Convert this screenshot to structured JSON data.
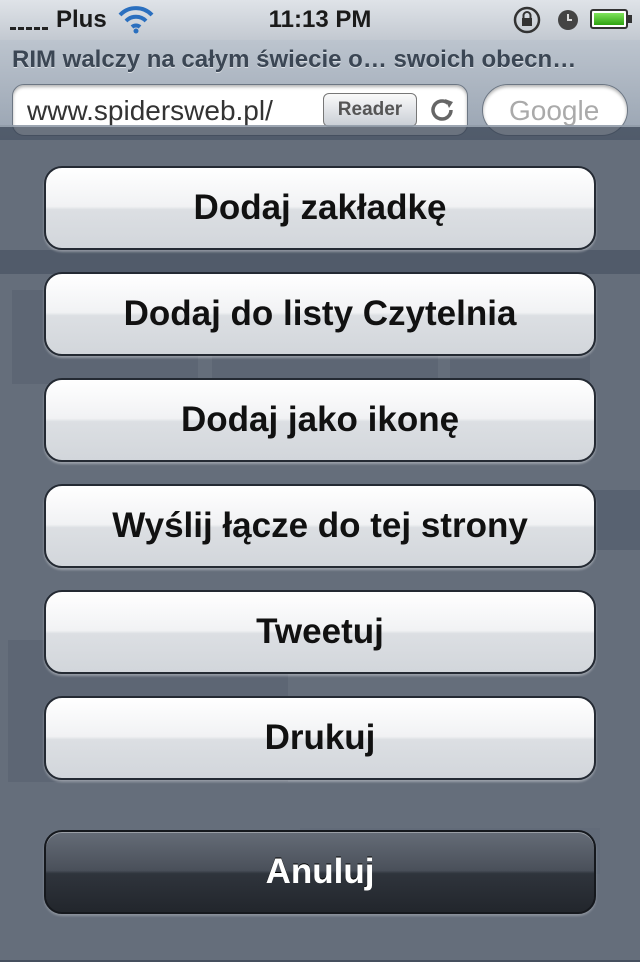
{
  "status_bar": {
    "carrier": "Plus",
    "time": "11:13 PM",
    "battery_level": 1.0
  },
  "browser": {
    "page_title": "RIM walczy na całym świecie o… swoich obecn…",
    "url": "www.spidersweb.pl/",
    "reader_label": "Reader",
    "search_placeholder": "Google"
  },
  "action_sheet": {
    "buttons": [
      {
        "label": "Dodaj zakładkę"
      },
      {
        "label": "Dodaj do listy Czytelnia"
      },
      {
        "label": "Dodaj jako ikonę"
      },
      {
        "label": "Wyślij łącze do tej strony"
      },
      {
        "label": "Tweetuj"
      },
      {
        "label": "Drukuj"
      }
    ],
    "cancel_label": "Anuluj"
  },
  "colors": {
    "overlay": "#374252",
    "cancel_button": "#2f343c",
    "battery_green": "#2ea310"
  },
  "icons": [
    "signal-bars-icon",
    "wifi-icon",
    "rotation-lock-icon",
    "alarm-clock-icon",
    "battery-icon",
    "reload-icon"
  ]
}
